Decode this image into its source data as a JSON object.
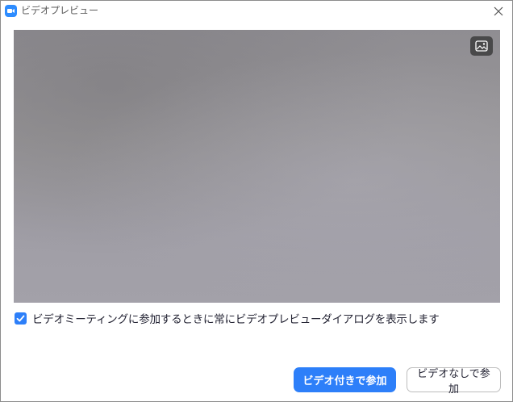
{
  "window": {
    "title": "ビデオプレビュー",
    "app_icon": "zoom-camera-icon",
    "close_icon": "close-icon"
  },
  "preview": {
    "background_button_icon": "virtual-background-icon"
  },
  "options": {
    "always_show_preview_label": "ビデオミーティングに参加するときに常にビデオプレビューダイアログを表示します",
    "always_show_preview_checked": true
  },
  "actions": {
    "join_with_video_label": "ビデオ付きで参加",
    "join_without_video_label": "ビデオなしで参加"
  },
  "colors": {
    "accent": "#2d7ff9",
    "brand": "#2d8cff"
  }
}
